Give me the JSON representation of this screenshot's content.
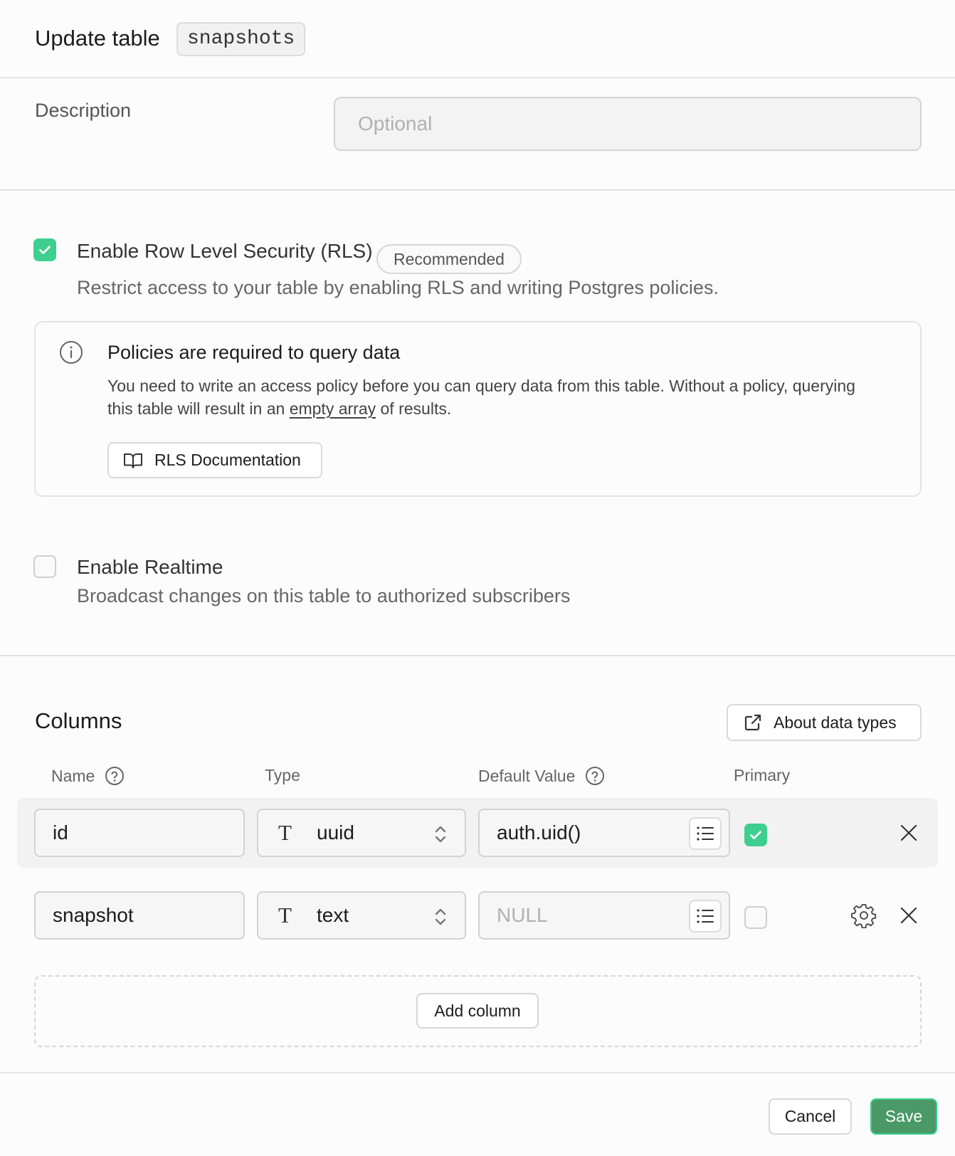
{
  "header": {
    "title": "Update table",
    "table_name": "snapshots"
  },
  "description": {
    "label": "Description",
    "placeholder": "Optional",
    "value": ""
  },
  "rls": {
    "checked": true,
    "title": "Enable Row Level Security (RLS)",
    "badge": "Recommended",
    "subtitle": "Restrict access to your table by enabling RLS and writing Postgres policies."
  },
  "callout": {
    "title": "Policies are required to query data",
    "body_before": "You need to write an access policy before you can query data from this table. Without a policy, querying this table will result in an ",
    "body_link": "empty array",
    "body_after": " of results.",
    "button": "RLS Documentation"
  },
  "realtime": {
    "checked": false,
    "title": "Enable Realtime",
    "subtitle": "Broadcast changes on this table to authorized subscribers"
  },
  "columns": {
    "title": "Columns",
    "about_button": "About data types",
    "headers": {
      "name": "Name",
      "type": "Type",
      "default": "Default Value",
      "primary": "Primary"
    },
    "rows": [
      {
        "name": "id",
        "type_glyph": "T",
        "type": "uuid",
        "default": "auth.uid()",
        "default_placeholder": "",
        "primary": true
      },
      {
        "name": "snapshot",
        "type_glyph": "T",
        "type": "text",
        "default": "",
        "default_placeholder": "NULL",
        "primary": false
      }
    ],
    "add_button": "Add column"
  },
  "footer": {
    "cancel": "Cancel",
    "save": "Save"
  },
  "colors": {
    "accent": "#3ecf8e",
    "save_bg": "#4a9966"
  }
}
